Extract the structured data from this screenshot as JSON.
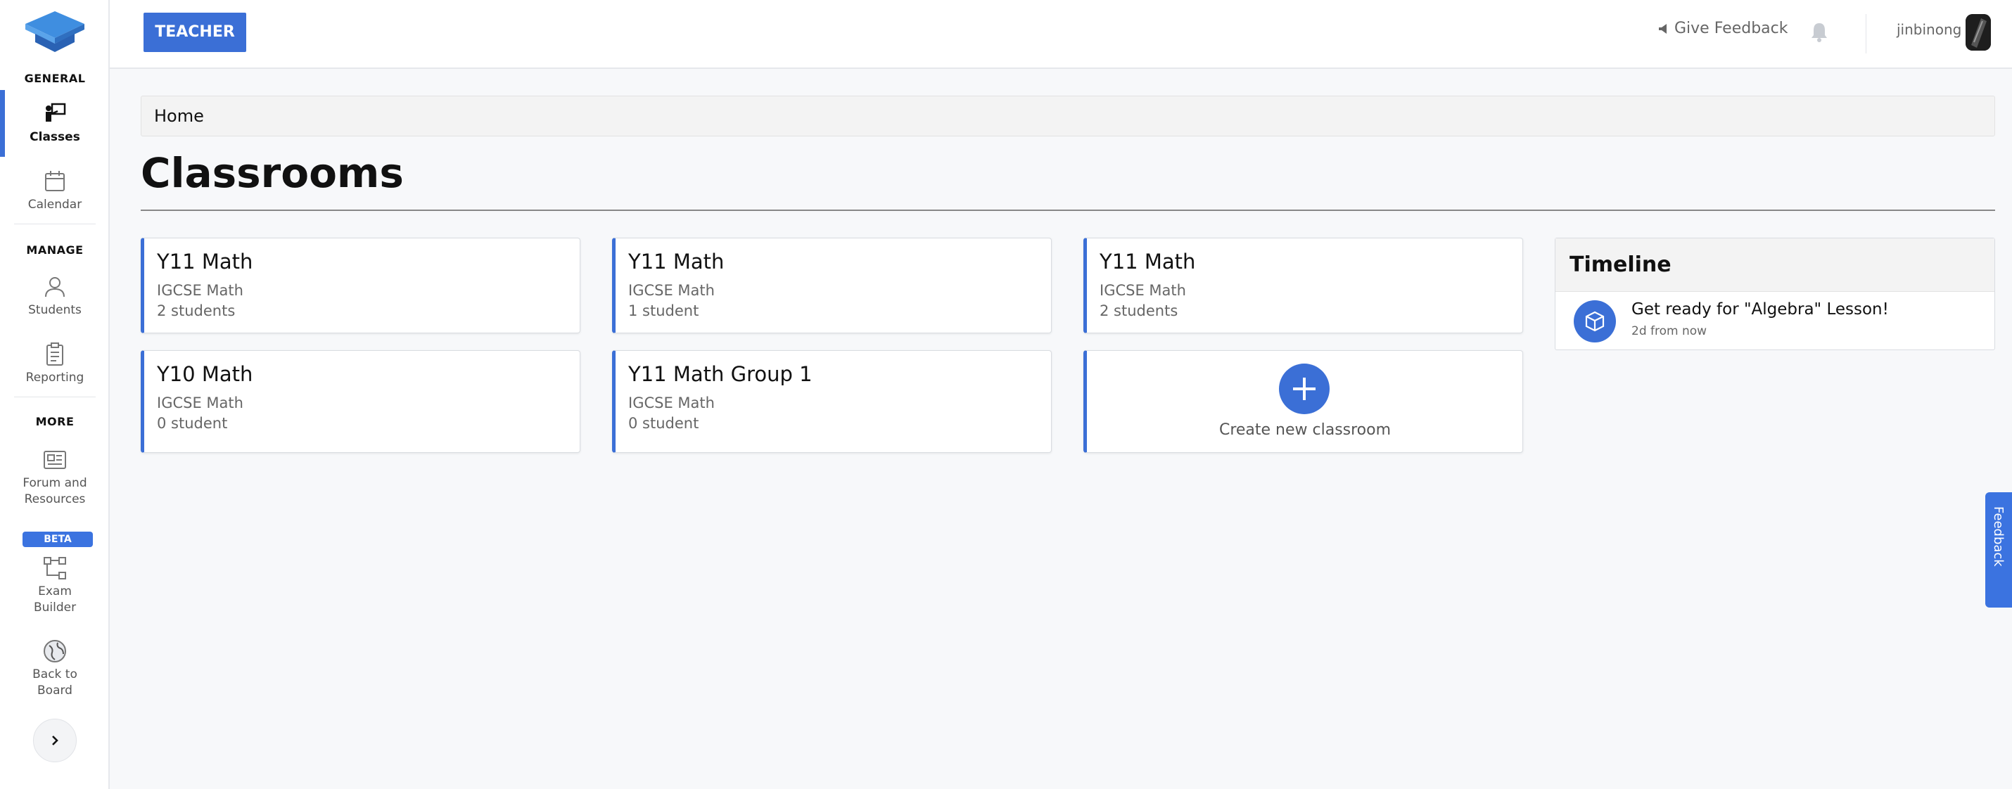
{
  "sidebar": {
    "sections": {
      "general": "GENERAL",
      "manage": "MANAGE",
      "more": "MORE"
    },
    "items": {
      "classes": "Classes",
      "calendar": "Calendar",
      "students": "Students",
      "reporting": "Reporting",
      "forum_line1": "Forum and",
      "forum_line2": "Resources",
      "exam_line1": "Exam",
      "exam_line2": "Builder",
      "board_line1": "Back to",
      "board_line2": "Board"
    },
    "beta_badge": "BETA",
    "active_item": "Classes",
    "accent_color": "#3b6fd6"
  },
  "topbar": {
    "role_button": "TEACHER",
    "give_feedback": "Give Feedback",
    "username": "jinbinong"
  },
  "breadcrumb": "Home",
  "page_title": "Classrooms",
  "classrooms": [
    {
      "title": "Y11 Math",
      "subject": "IGCSE Math",
      "count": "2 students"
    },
    {
      "title": "Y11 Math",
      "subject": "IGCSE Math",
      "count": "1 student"
    },
    {
      "title": "Y11 Math",
      "subject": "IGCSE Math",
      "count": "2 students"
    },
    {
      "title": "Y10 Math",
      "subject": "IGCSE Math",
      "count": "0 student"
    },
    {
      "title": "Y11 Math Group 1",
      "subject": "IGCSE Math",
      "count": "0 student"
    }
  ],
  "create_classroom": "Create new classroom",
  "timeline": {
    "title": "Timeline",
    "items": [
      {
        "title": "Get ready for \"Algebra\" Lesson!",
        "time": "2d from now"
      }
    ]
  },
  "feedback_tab": "Feedback"
}
